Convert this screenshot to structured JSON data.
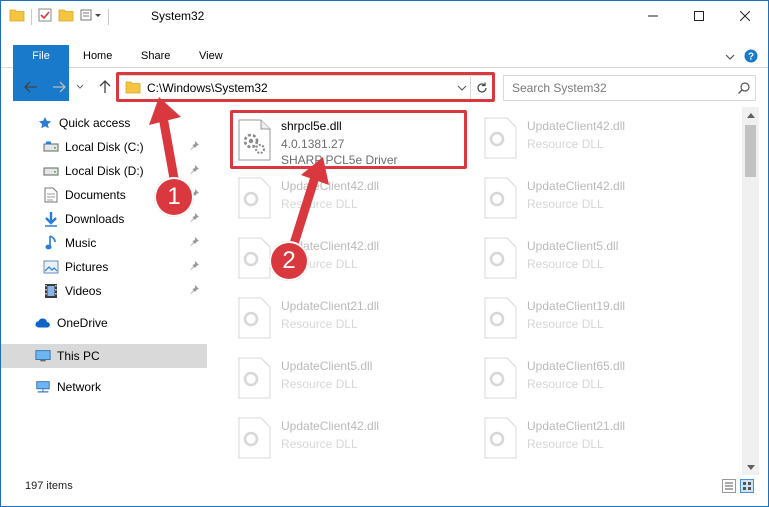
{
  "window": {
    "title": "System32",
    "minimize_icon": "minimize-icon",
    "maximize_icon": "maximize-icon",
    "close_icon": "close-icon"
  },
  "ribbon": {
    "tabs": [
      {
        "label": "File"
      },
      {
        "label": "Home"
      },
      {
        "label": "Share"
      },
      {
        "label": "View"
      }
    ]
  },
  "address": {
    "path": "C:\\Windows\\System32"
  },
  "search": {
    "placeholder": "Search System32"
  },
  "sidebar": {
    "items": [
      {
        "label": "Quick access",
        "icon": "star-icon"
      },
      {
        "label": "Local Disk (C:)",
        "icon": "drive-icon",
        "pinned": true
      },
      {
        "label": "Local Disk (D:)",
        "icon": "drive-icon",
        "pinned": true
      },
      {
        "label": "Documents",
        "icon": "documents-icon",
        "pinned": true
      },
      {
        "label": "Downloads",
        "icon": "download-icon",
        "pinned": true
      },
      {
        "label": "Music",
        "icon": "music-icon",
        "pinned": true
      },
      {
        "label": "Pictures",
        "icon": "pictures-icon",
        "pinned": true
      },
      {
        "label": "Videos",
        "icon": "videos-icon",
        "pinned": true
      },
      {
        "label": "OneDrive",
        "icon": "cloud-icon"
      },
      {
        "label": "This PC",
        "icon": "computer-icon",
        "selected": true
      },
      {
        "label": "Network",
        "icon": "network-icon"
      }
    ]
  },
  "files": {
    "highlighted": {
      "name": "shrpcl5e.dll",
      "version": "4.0.1381.27",
      "description": "SHARP PCL5e Driver"
    },
    "items": [
      {
        "name": "UpdateClient42.dll",
        "description": "Resource DLL"
      },
      {
        "name": "UpdateClient42.dll",
        "description": "Resource DLL"
      },
      {
        "name": "UpdateClient42.dll",
        "description": "Resource DLL"
      },
      {
        "name": "UpdateClient42.dll",
        "description": "Resource DLL"
      },
      {
        "name": "UpdateClient5.dll",
        "description": "Resource DLL"
      },
      {
        "name": "UpdateClient21.dll",
        "description": "Resource DLL"
      },
      {
        "name": "UpdateClient19.dll",
        "description": "Resource DLL"
      },
      {
        "name": "UpdateClient5.dll",
        "description": "Resource DLL"
      },
      {
        "name": "UpdateClient65.dll",
        "description": "Resource DLL"
      },
      {
        "name": "UpdateClient42.dll",
        "description": "Resource DLL"
      },
      {
        "name": "UpdateClient21.dll",
        "description": "Resource DLL"
      }
    ]
  },
  "status": {
    "item_count": "197 items"
  },
  "callouts": {
    "step1": "1",
    "step2": "2"
  },
  "colors": {
    "accent": "#1979ca",
    "highlight_red": "#d9393e",
    "selected_bg": "#d9d9d9"
  }
}
